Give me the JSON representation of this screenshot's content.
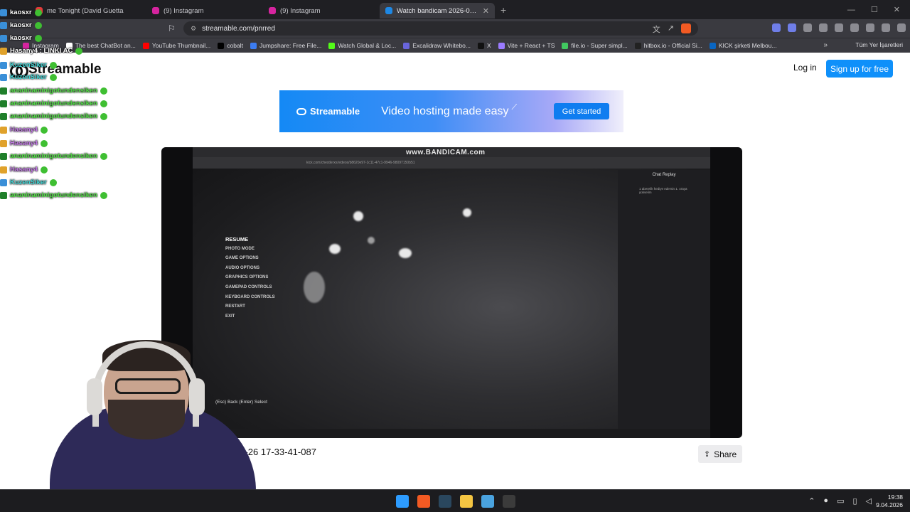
{
  "browser": {
    "tabs": [
      {
        "title": "me Tonight (David Guetta",
        "favicon_color": "#e33b3b",
        "active": false
      },
      {
        "title": "(9) Instagram",
        "favicon_color": "#d6249f",
        "active": false
      },
      {
        "title": "(9) Instagram",
        "favicon_color": "#d6249f",
        "active": false
      },
      {
        "title": "Watch bandicam 2026-02-26",
        "favicon_color": "#1e88e5",
        "active": true
      }
    ],
    "url": "streamable.com/pnrred",
    "bookmarks": [
      {
        "label": "Instagram",
        "color": "#d6249f"
      },
      {
        "label": "The best ChatBot an...",
        "color": "#ffffff"
      },
      {
        "label": "YouTube Thumbnail...",
        "color": "#ff0000"
      },
      {
        "label": "cobalt",
        "color": "#000000"
      },
      {
        "label": "Jumpshare: Free File...",
        "color": "#3c7df2"
      },
      {
        "label": "Watch Global & Loc...",
        "color": "#53fc18"
      },
      {
        "label": "Excalidraw Whitebo...",
        "color": "#6965db"
      },
      {
        "label": "X",
        "color": "#111111"
      },
      {
        "label": "Vite + React + TS",
        "color": "#9b7bff"
      },
      {
        "label": "file.io - Super simpl...",
        "color": "#41c860"
      },
      {
        "label": "hitbox.io - Official Si...",
        "color": "#222222"
      },
      {
        "label": "KICK şirketi Melbou...",
        "color": "#0a66c2"
      }
    ],
    "bookmarks_folder": "Tüm Yer İşaretleri"
  },
  "page": {
    "logo": "Streamable",
    "login": "Log in",
    "signup": "Sign up for free",
    "banner": {
      "brand": "Streamable",
      "tagline": "Video hosting made easy",
      "cta": "Get started"
    },
    "video": {
      "watermark": "www.BANDICAM.com",
      "menu": [
        "RESUME",
        "PHOTO MODE",
        "GAME OPTIONS",
        "AUDIO OPTIONS",
        "GRAPHICS OPTIONS",
        "GAMEPAD CONTROLS",
        "KEYBOARD CONTROLS",
        "RESTART",
        "EXIT"
      ],
      "hint": "(Esc) Back  (Enter) Select",
      "chat_header": "Chat Replay",
      "chat_msg": "1 aberelik hediye edersin 1. oraya yükselim",
      "inner_url": "kick.com/chestlerxx/videos/b8620e97-1c11-47c1-9946-98097150b51"
    },
    "title": "02-26 17-33-41-087",
    "share": "Share"
  },
  "chat_overlay": [
    {
      "user": "kaosxr",
      "color": "#ffffff",
      "badge": "#3a8fd8"
    },
    {
      "user": "kaosxr",
      "color": "#ffffff",
      "badge": "#3a8fd8"
    },
    {
      "user": "kaosxr",
      "color": "#ffffff",
      "badge": "#3a8fd8"
    },
    {
      "user": "Hasany4 : LINKI AC",
      "color": "#ffffff",
      "badge": "#e0a22b"
    },
    {
      "user": "KuzenSiker",
      "color": "#3fd6d6",
      "badge": "#3a8fd8"
    },
    {
      "user": "KuzenSiker",
      "color": "#3fd6d6",
      "badge": "#3a8fd8"
    },
    {
      "user": "ananinaminigotundensiken",
      "color": "#4fe043",
      "badge": "#1f7f2a"
    },
    {
      "user": "ananinaminigotundensiken",
      "color": "#4fe043",
      "badge": "#1f7f2a"
    },
    {
      "user": "ananinaminigotundensiken",
      "color": "#4fe043",
      "badge": "#1f7f2a"
    },
    {
      "user": "Hasany4",
      "color": "#c57be8",
      "badge": "#e0a22b"
    },
    {
      "user": "Hasany4",
      "color": "#c57be8",
      "badge": "#e0a22b"
    },
    {
      "user": "ananinaminigotundensiken",
      "color": "#4fe043",
      "badge": "#1f7f2a"
    },
    {
      "user": "Hasany4",
      "color": "#c57be8",
      "badge": "#e0a22b"
    },
    {
      "user": "KuzenSiker",
      "color": "#3fd6d6",
      "badge": "#3a8fd8"
    },
    {
      "user": "ananinaminigotundensiken",
      "color": "#4fe043",
      "badge": "#1f7f2a"
    }
  ],
  "taskbar": {
    "time": "19:38",
    "date": "9.04.2026",
    "apps": [
      {
        "name": "start-icon",
        "color": "#2d9cff"
      },
      {
        "name": "brave-icon",
        "color": "#f25a23"
      },
      {
        "name": "steam-icon",
        "color": "#2a475e"
      },
      {
        "name": "folder-icon",
        "color": "#f4c542"
      },
      {
        "name": "photos-icon",
        "color": "#4aa3df"
      },
      {
        "name": "app-icon",
        "color": "#3b3b3b"
      }
    ]
  }
}
